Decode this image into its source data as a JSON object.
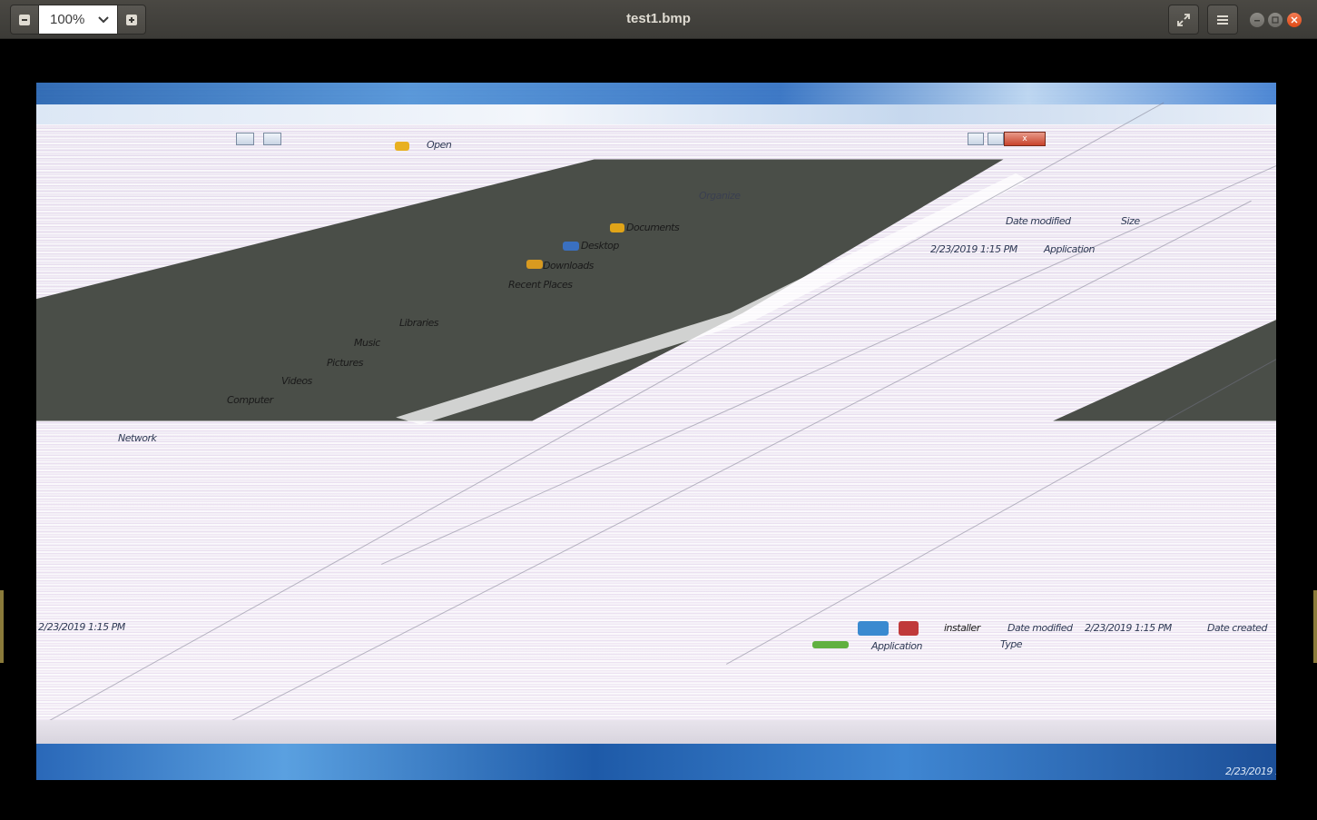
{
  "window": {
    "title": "test1.bmp"
  },
  "toolbar": {
    "zoom_value": "100%",
    "zoom_out_label": "−",
    "zoom_in_label": "+"
  },
  "image": {
    "texts": {
      "t1": "Open",
      "t2": "Organize",
      "t3": "Documents",
      "t4": "Desktop",
      "t5": "Downloads",
      "t6": "Recent Places",
      "t7": "Libraries",
      "t8": "Music",
      "t9": "Pictures",
      "t10": "Videos",
      "t11": "Computer",
      "t12": "Network",
      "t13": "Date modified",
      "t14": "Size",
      "t15": "Type",
      "t16": "2/23/2019 1:15 PM",
      "t17": "Application",
      "t18": "Date created",
      "t19": "installer"
    }
  },
  "icons": {
    "zoom_out": "zoom-out-icon",
    "zoom_in": "zoom-in-icon",
    "dropdown": "chevron-down-icon",
    "fullscreen": "fullscreen-icon",
    "menu": "hamburger-menu-icon",
    "minimize": "window-minimize-icon",
    "maximize": "window-maximize-icon",
    "close": "window-close-icon"
  },
  "colors": {
    "header_bg": "#3c3b37",
    "close_accent": "#df4a16",
    "viewer_bg": "#000000"
  }
}
